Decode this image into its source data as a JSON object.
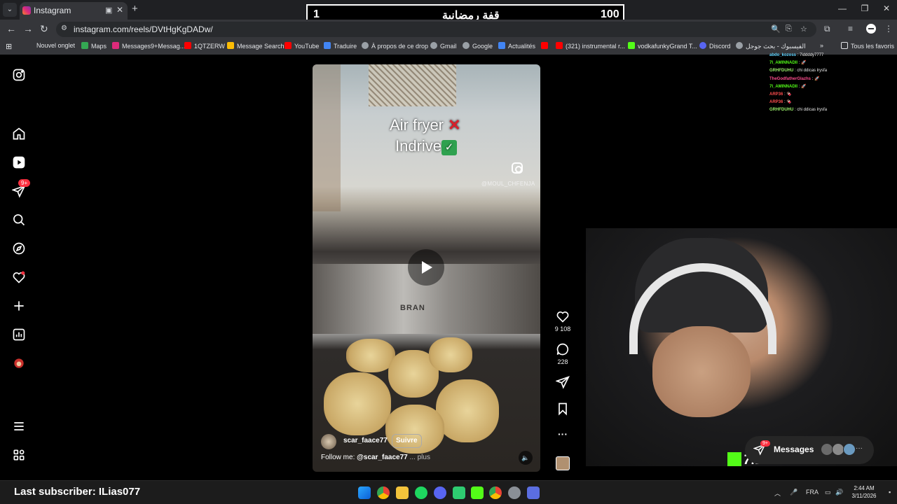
{
  "browser": {
    "tab_title": "Instagram",
    "url": "instagram.com/reels/DVtHgKgDADw/",
    "bookmarks": [
      {
        "label": "Nouvel onglet",
        "icon": "page-icon",
        "color": "#35363a"
      },
      {
        "label": "Maps",
        "icon": "maps-icon",
        "color": "#34a853"
      },
      {
        "label": "Messages9+Messag...",
        "icon": "instagram-icon",
        "color": "#dd2a7b"
      },
      {
        "label": "1QTZERW",
        "icon": "youtube-icon",
        "color": "#ff0000"
      },
      {
        "label": "Message Search",
        "icon": "chart-icon",
        "color": "#fbbc04"
      },
      {
        "label": "YouTube",
        "icon": "youtube-icon",
        "color": "#ff0000"
      },
      {
        "label": "Traduire",
        "icon": "translate-icon",
        "color": "#4285f4"
      },
      {
        "label": "À propos de ce drop",
        "icon": "globe-icon",
        "color": "#9aa0a6"
      },
      {
        "label": "Gmail",
        "icon": "google-icon",
        "color": "#9aa0a6"
      },
      {
        "label": "Google",
        "icon": "google-icon",
        "color": "#9aa0a6"
      },
      {
        "label": "Actualités",
        "icon": "news-icon",
        "color": "#4285f4"
      },
      {
        "label": "",
        "icon": "youtube-icon",
        "color": "#ff0000"
      },
      {
        "label": "(321) instrumental r...",
        "icon": "youtube-icon",
        "color": "#ff0000"
      },
      {
        "label": "vodkafunkyGrand T...",
        "icon": "kick-icon",
        "color": "#53fc18"
      },
      {
        "label": "Discord",
        "icon": "discord-icon",
        "color": "#5865f2"
      },
      {
        "label": "الفيسبوك - بحث جوجل",
        "icon": "google-icon",
        "color": "#9aa0a6"
      }
    ],
    "all_bookmarks": "Tous les favoris"
  },
  "score": {
    "left": "1",
    "title": "قفة رمضانية",
    "right": "100"
  },
  "sidebar": {
    "notifications_badge": "9+"
  },
  "reel": {
    "overlay_line1": "Air fryer",
    "overlay_line2": "Indrive",
    "watermark": "@MOUL_CHFENJA",
    "brand_text": "BRAN",
    "username": "scar_faace77",
    "follow_label": "Suivre",
    "caption_prefix": "Follow me: ",
    "caption_handle": "@scar_faace77",
    "caption_more": " ... plus",
    "likes": "9 108",
    "comments": "228"
  },
  "chat": [
    {
      "user": "abdo_kozoss",
      "msg": " : 7iddddy7777",
      "color": "#5fd3ff"
    },
    {
      "user": "7I_AMINNADII",
      "msg": " : 🚀",
      "color": "#53fc18"
    },
    {
      "user": "GRHFDUHU",
      "msg": " : chi ddicas lrysfa",
      "color": "#9bf26a"
    },
    {
      "user": "TheGodfatherGlazhs",
      "msg": " : 🚀",
      "color": "#ff4d8f"
    },
    {
      "user": "7I_AMINNADII",
      "msg": " : 🚀",
      "color": "#53fc18"
    },
    {
      "user": "ARP36",
      "msg": " : 🍫",
      "color": "#ff4d4d"
    },
    {
      "user": "ARP36",
      "msg": " : 🍫",
      "color": "#ff4d4d"
    },
    {
      "user": "GRHFDUHU",
      "msg": " : chi ddicas lrysfa",
      "color": "#9bf26a"
    }
  ],
  "webcam": {
    "streamer_name": "7IDAN7777"
  },
  "messages": {
    "label": "Messages",
    "badge": "9+"
  },
  "stream": {
    "last_subscriber": "Last subscriber: ILias077"
  },
  "taskbar": {
    "language": "FRA",
    "time": "2:44 AM",
    "date": "3/11/2026"
  }
}
